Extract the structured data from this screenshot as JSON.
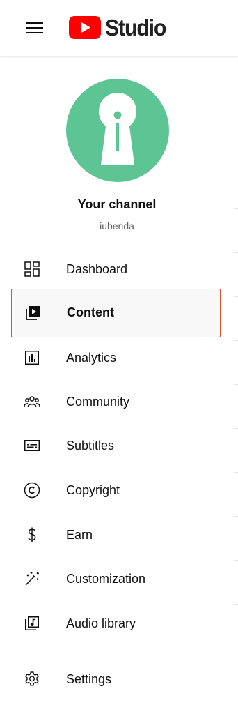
{
  "app": {
    "logo_text": "Studio"
  },
  "channel": {
    "title": "Your channel",
    "handle": "iubenda"
  },
  "nav": {
    "items": [
      {
        "label": "Dashboard",
        "icon": "dashboard-icon"
      },
      {
        "label": "Content",
        "icon": "content-icon",
        "active": true
      },
      {
        "label": "Analytics",
        "icon": "analytics-icon"
      },
      {
        "label": "Community",
        "icon": "community-icon"
      },
      {
        "label": "Subtitles",
        "icon": "subtitles-icon"
      },
      {
        "label": "Copyright",
        "icon": "copyright-icon"
      },
      {
        "label": "Earn",
        "icon": "dollar-icon"
      },
      {
        "label": "Customization",
        "icon": "magic-wand-icon"
      },
      {
        "label": "Audio library",
        "icon": "audio-library-icon"
      },
      {
        "label": "Settings",
        "icon": "gear-icon"
      }
    ]
  },
  "colors": {
    "brand_red": "#ff0000",
    "avatar_green": "#5dc594",
    "active_border": "#e0552f"
  }
}
